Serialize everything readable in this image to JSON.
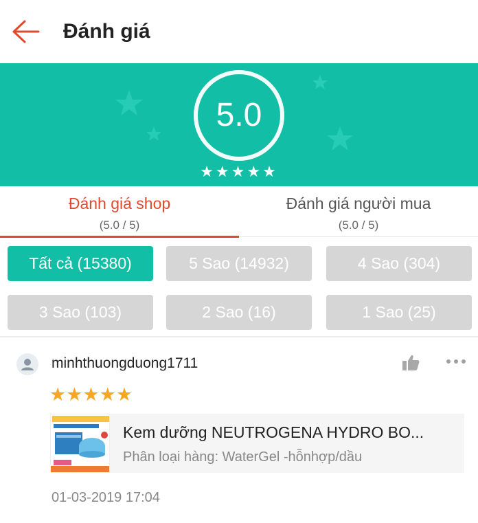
{
  "header": {
    "title": "Đánh giá",
    "back_icon": "back-arrow-icon",
    "accent": "#e04a2c"
  },
  "rating": {
    "score": "5.0",
    "stars": "★★★★★",
    "bg_color": "#12bfa6"
  },
  "tabs": [
    {
      "label": "Đánh giá shop",
      "sub": "(5.0 / 5)",
      "active": true
    },
    {
      "label": "Đánh giá người mua",
      "sub": "(5.0 / 5)",
      "active": false
    }
  ],
  "filters": [
    {
      "label": "Tất cả (15380)",
      "active": true
    },
    {
      "label": "5 Sao (14932)",
      "active": false
    },
    {
      "label": "4 Sao (304)",
      "active": false
    },
    {
      "label": "3 Sao (103)",
      "active": false
    },
    {
      "label": "2 Sao (16)",
      "active": false
    },
    {
      "label": "1 Sao (25)",
      "active": false
    }
  ],
  "review": {
    "username": "minhthuongduong1711",
    "stars": "★★★★★",
    "rating": 5,
    "like_icon": "thumbs-up-icon",
    "more_icon": "more-options-icon",
    "product": {
      "name": "Kem dưỡng NEUTROGENA HYDRO BO...",
      "variant": "Phân loại hàng: WaterGel -hỗnhợp/dầu"
    },
    "date": "01-03-2019 17:04"
  }
}
